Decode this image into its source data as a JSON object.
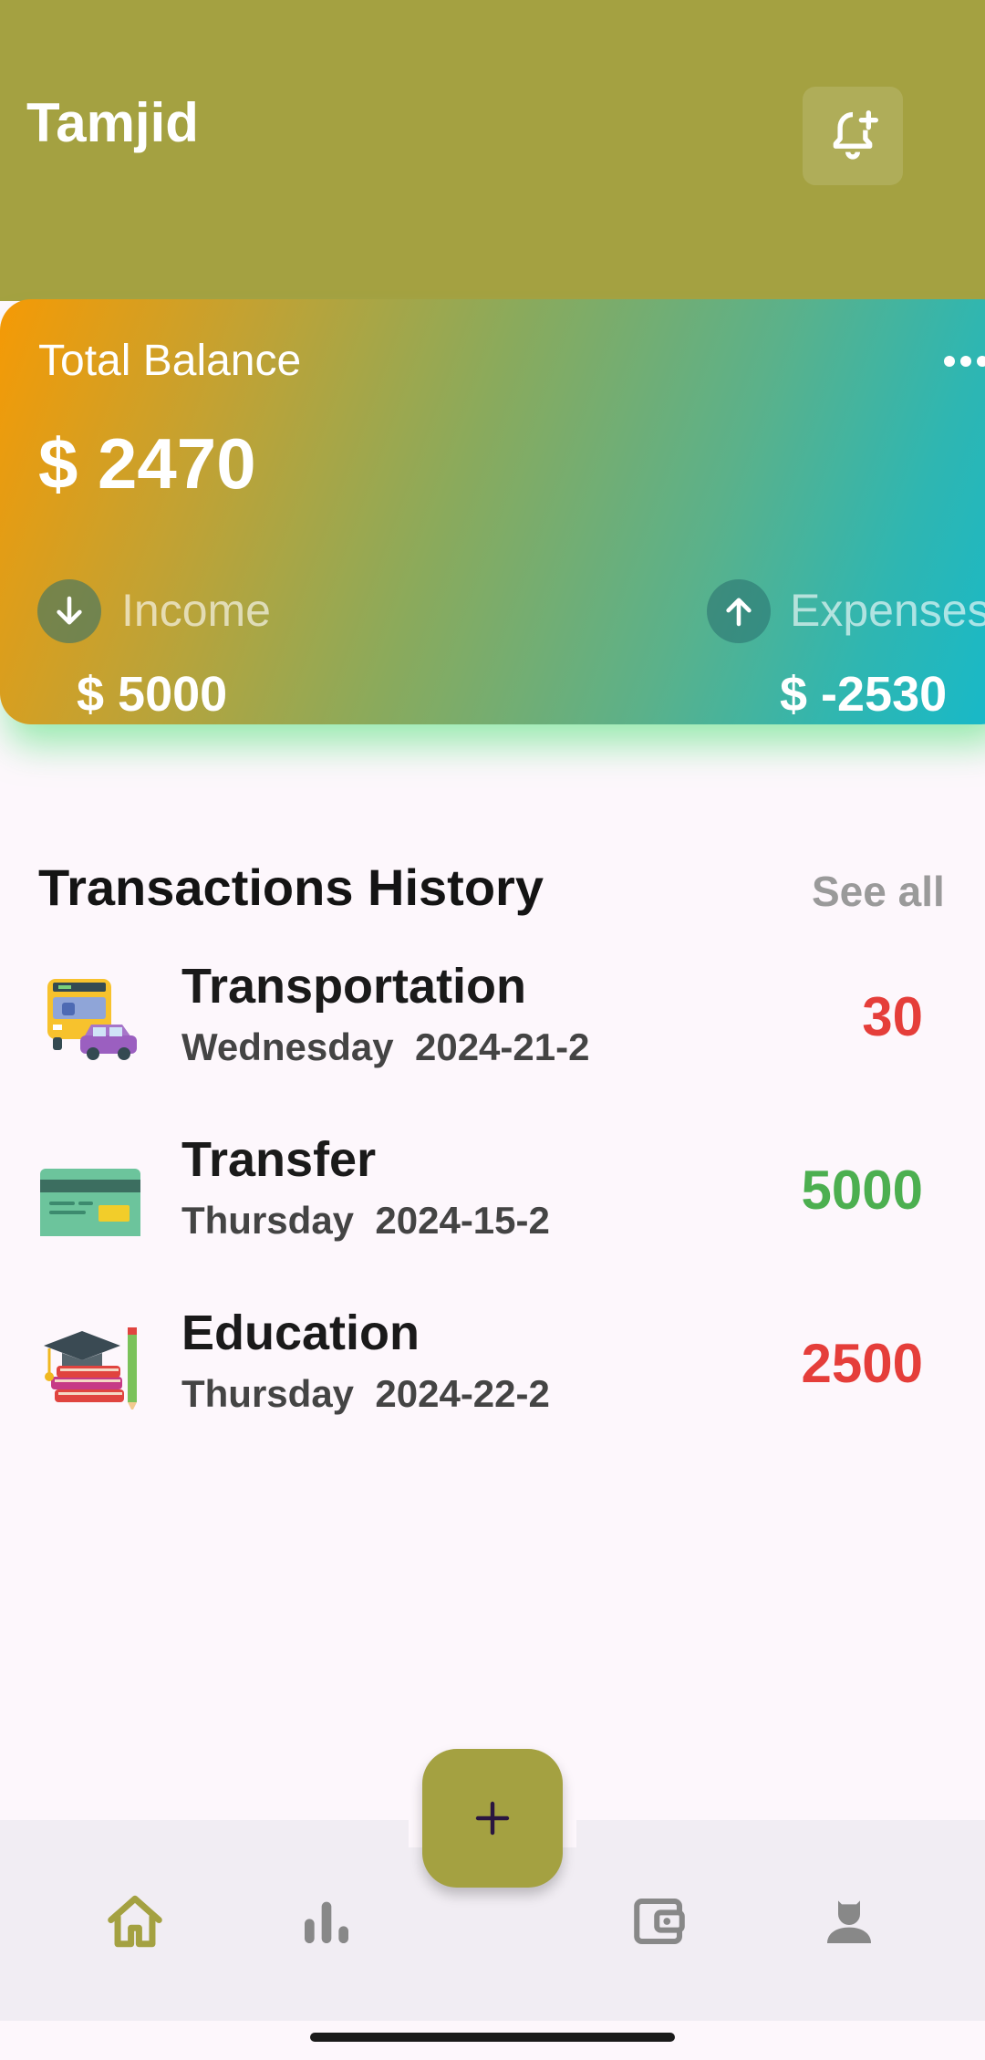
{
  "header": {
    "user_name": "Tamjid",
    "notify_icon": "bell-plus-icon"
  },
  "balance": {
    "label": "Total Balance",
    "amount": "$ 2470",
    "income_label": "Income",
    "income_amount": "$ 5000",
    "expenses_label": "Expenses",
    "expenses_amount": "$ -2530"
  },
  "transactions": {
    "title": "Transactions History",
    "see_all": "See all",
    "items": [
      {
        "icon": "transportation-icon",
        "title": "Transportation",
        "date": "Wednesday  2024-21-2",
        "amount": "30",
        "color": "#e53e3a"
      },
      {
        "icon": "credit-card-icon",
        "title": "Transfer",
        "date": "Thursday  2024-15-2",
        "amount": "5000",
        "color": "#4caf50"
      },
      {
        "icon": "education-icon",
        "title": "Education",
        "date": "Thursday  2024-22-2",
        "amount": "2500",
        "color": "#e53e3a"
      }
    ]
  },
  "nav": {
    "items": [
      "home-icon",
      "stats-icon",
      "wallet-icon",
      "profile-icon"
    ],
    "fab_icon": "plus-icon"
  },
  "colors": {
    "brand": "#a4a141",
    "expense": "#e53e3a",
    "income": "#4caf50"
  }
}
